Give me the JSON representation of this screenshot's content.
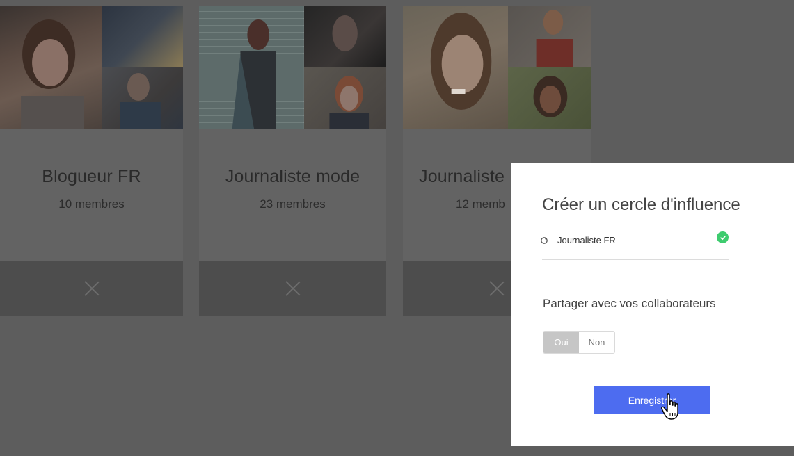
{
  "cards": [
    {
      "title": "Blogueur FR",
      "subtitle": "10 membres"
    },
    {
      "title": "Journaliste mode",
      "subtitle": "23 membres"
    },
    {
      "title": "Journaliste",
      "subtitle": "12 memb"
    }
  ],
  "modal": {
    "title": "Créer un cercle d'influence",
    "field_value": "Journaliste FR",
    "share_label": "Partager avec vos collaborateurs",
    "toggle_yes": "Oui",
    "toggle_no": "Non",
    "save_label": "Enregistrer"
  },
  "colors": {
    "overlay": "#5d5d5d",
    "primary": "#4d6cf0",
    "success": "#3ecc6f"
  },
  "icons": [
    "close-icon",
    "tag-icon",
    "check-icon",
    "hand-cursor-icon"
  ]
}
